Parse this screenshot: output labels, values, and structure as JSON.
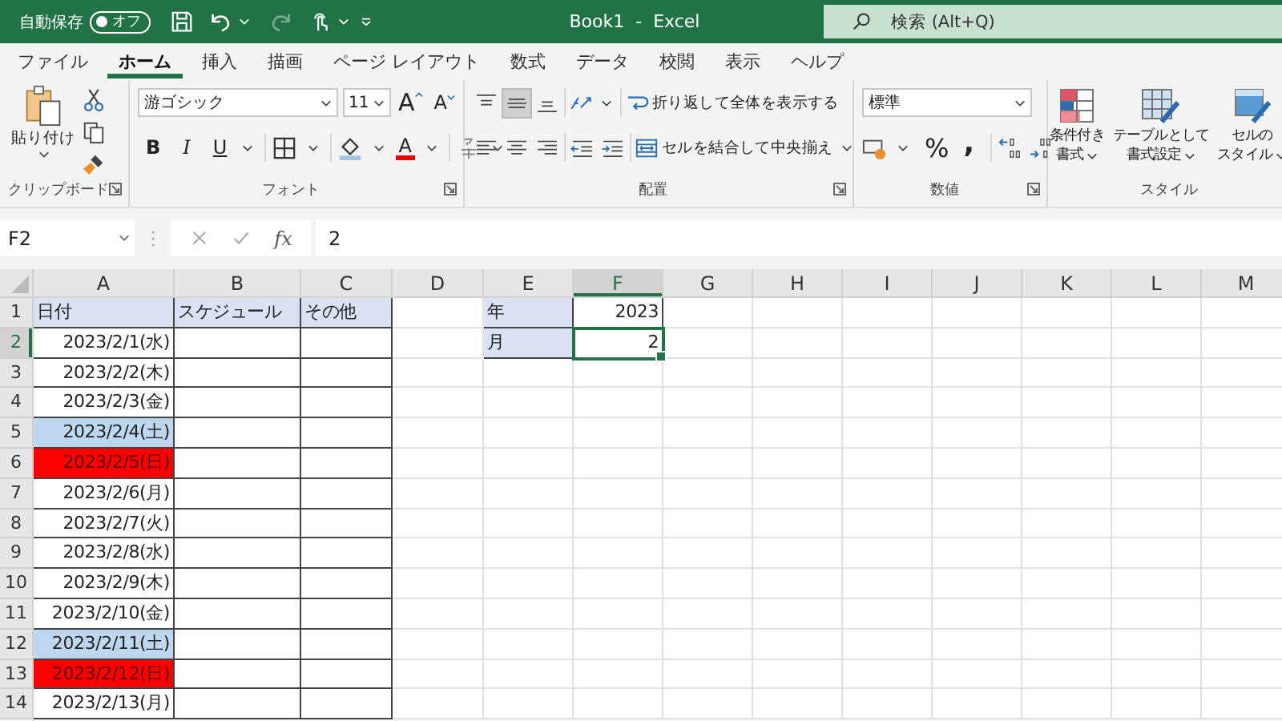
{
  "title_bar": {
    "autosave_label": "自動保存",
    "autosave_toggle": {
      "label": "オフ",
      "on": false
    },
    "redo_disabled": true,
    "document_title": "Book1  -  Excel",
    "search": {
      "placeholder": "検索 (Alt+Q)"
    }
  },
  "ribbon_tabs": [
    {
      "label": "ファイル",
      "selected": false
    },
    {
      "label": "ホーム",
      "selected": true
    },
    {
      "label": "挿入",
      "selected": false
    },
    {
      "label": "描画",
      "selected": false
    },
    {
      "label": "ページ レイアウト",
      "selected": false
    },
    {
      "label": "数式",
      "selected": false
    },
    {
      "label": "データ",
      "selected": false
    },
    {
      "label": "校閲",
      "selected": false
    },
    {
      "label": "表示",
      "selected": false
    },
    {
      "label": "ヘルプ",
      "selected": false
    }
  ],
  "ribbon": {
    "clipboard": {
      "paste_label": "貼り付け",
      "group_label": "クリップボード"
    },
    "font": {
      "font_name": "游ゴシック",
      "font_size": "11",
      "grow": "A",
      "shrink": "A",
      "bold": "B",
      "italic": "I",
      "underline": "U",
      "font_color": "A",
      "group_label": "フォント"
    },
    "alignment": {
      "vertical_align": [
        {
          "kind": "top",
          "selected": false
        },
        {
          "kind": "middle",
          "selected": true
        },
        {
          "kind": "bottom",
          "selected": false
        }
      ],
      "wrap_text": "折り返して全体を表示する",
      "merge_center": "セルを結合して中央揃え",
      "group_label": "配置"
    },
    "number": {
      "format": "標準",
      "percent": "%",
      "comma": ",",
      "group_label": "数値"
    },
    "styles": {
      "buttons": [
        {
          "kind": "conditional",
          "lines": [
            "条件付き",
            "書式"
          ]
        },
        {
          "kind": "table",
          "lines": [
            "テーブルとして",
            "書式設定"
          ]
        },
        {
          "kind": "cell",
          "lines": [
            "セルの",
            "スタイル"
          ]
        }
      ],
      "group_label": "スタイル"
    }
  },
  "formula_bar": {
    "name_box": "F2",
    "function_label": "fx",
    "formula": "2"
  },
  "sheet": {
    "columns": [
      {
        "label": "A",
        "selected": false
      },
      {
        "label": "B",
        "selected": false
      },
      {
        "label": "C",
        "selected": false
      },
      {
        "label": "D",
        "selected": false
      },
      {
        "label": "E",
        "selected": false
      },
      {
        "label": "F",
        "selected": true
      },
      {
        "label": "G",
        "selected": false
      },
      {
        "label": "H",
        "selected": false
      },
      {
        "label": "I",
        "selected": false
      },
      {
        "label": "J",
        "selected": false
      },
      {
        "label": "K",
        "selected": false
      },
      {
        "label": "L",
        "selected": false
      },
      {
        "label": "M",
        "selected": false
      }
    ],
    "rows": [
      {
        "number": "1",
        "selected": false,
        "cells": [
          {
            "text": "日付",
            "kind": "label",
            "selected": false
          },
          {
            "text": "スケジュール",
            "kind": "label",
            "selected": false
          },
          {
            "text": "その他",
            "kind": "label",
            "selected": false
          },
          {
            "kind": "blank",
            "selected": false
          },
          {
            "text": "年",
            "kind": "label",
            "selected": false
          },
          {
            "text": "2023",
            "kind": "value",
            "selected": false
          }
        ]
      },
      {
        "number": "2",
        "selected": true,
        "cells": [
          {
            "text": "2023/2/1(水)",
            "kind": "date",
            "selected": false
          },
          {
            "kind": "empty",
            "selected": false
          },
          {
            "kind": "empty",
            "selected": false
          },
          {
            "kind": "blank",
            "selected": false
          },
          {
            "text": "月",
            "kind": "label",
            "selected": false
          },
          {
            "text": "2",
            "kind": "value",
            "selected": true
          }
        ]
      },
      {
        "number": "3",
        "selected": false,
        "cells": [
          {
            "text": "2023/2/2(木)",
            "kind": "date",
            "selected": false
          },
          {
            "kind": "empty",
            "selected": false
          },
          {
            "kind": "empty",
            "selected": false
          }
        ]
      },
      {
        "number": "4",
        "selected": false,
        "cells": [
          {
            "text": "2023/2/3(金)",
            "kind": "date",
            "selected": false
          },
          {
            "kind": "empty",
            "selected": false
          },
          {
            "kind": "empty",
            "selected": false
          }
        ]
      },
      {
        "number": "5",
        "selected": false,
        "cells": [
          {
            "text": "2023/2/4(土)",
            "kind": "saturday",
            "selected": false
          },
          {
            "kind": "empty",
            "selected": false
          },
          {
            "kind": "empty",
            "selected": false
          }
        ]
      },
      {
        "number": "6",
        "selected": false,
        "cells": [
          {
            "text": "2023/2/5(日)",
            "kind": "sunday",
            "selected": false
          },
          {
            "kind": "empty",
            "selected": false
          },
          {
            "kind": "empty",
            "selected": false
          }
        ]
      },
      {
        "number": "7",
        "selected": false,
        "cells": [
          {
            "text": "2023/2/6(月)",
            "kind": "date",
            "selected": false
          },
          {
            "kind": "empty",
            "selected": false
          },
          {
            "kind": "empty",
            "selected": false
          }
        ]
      },
      {
        "number": "8",
        "selected": false,
        "cells": [
          {
            "text": "2023/2/7(火)",
            "kind": "date",
            "selected": false
          },
          {
            "kind": "empty",
            "selected": false
          },
          {
            "kind": "empty",
            "selected": false
          }
        ]
      },
      {
        "number": "9",
        "selected": false,
        "cells": [
          {
            "text": "2023/2/8(水)",
            "kind": "date",
            "selected": false
          },
          {
            "kind": "empty",
            "selected": false
          },
          {
            "kind": "empty",
            "selected": false
          }
        ]
      },
      {
        "number": "10",
        "selected": false,
        "cells": [
          {
            "text": "2023/2/9(木)",
            "kind": "date",
            "selected": false
          },
          {
            "kind": "empty",
            "selected": false
          },
          {
            "kind": "empty",
            "selected": false
          }
        ]
      },
      {
        "number": "11",
        "selected": false,
        "cells": [
          {
            "text": "2023/2/10(金)",
            "kind": "date",
            "selected": false
          },
          {
            "kind": "empty",
            "selected": false
          },
          {
            "kind": "empty",
            "selected": false
          }
        ]
      },
      {
        "number": "12",
        "selected": false,
        "cells": [
          {
            "text": "2023/2/11(土)",
            "kind": "saturday",
            "selected": false
          },
          {
            "kind": "empty",
            "selected": false
          },
          {
            "kind": "empty",
            "selected": false
          }
        ]
      },
      {
        "number": "13",
        "selected": false,
        "cells": [
          {
            "text": "2023/2/12(日)",
            "kind": "sunday",
            "selected": false
          },
          {
            "kind": "empty",
            "selected": false
          },
          {
            "kind": "empty",
            "selected": false
          }
        ]
      },
      {
        "number": "14",
        "selected": false,
        "cells": [
          {
            "text": "2023/2/13(月)",
            "kind": "date",
            "selected": false
          },
          {
            "kind": "empty",
            "selected": false
          },
          {
            "kind": "empty",
            "selected": false
          }
        ]
      }
    ]
  }
}
